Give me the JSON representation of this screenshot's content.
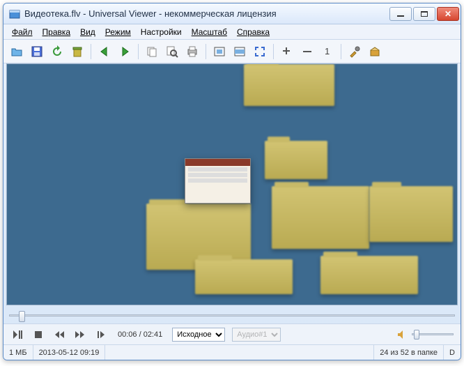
{
  "title": "Видеотека.flv - Universal Viewer - некоммерческая лицензия",
  "menu": {
    "file": "Файл",
    "edit": "Правка",
    "view": "Вид",
    "mode": "Режим",
    "settings": "Настройки",
    "zoom": "Масштаб",
    "help": "Справка"
  },
  "toolbar_icons": {
    "open": "open-icon",
    "save": "save-icon",
    "reload": "reload-icon",
    "delete": "delete-icon",
    "back": "back-icon",
    "forward": "forward-icon",
    "copy": "copy-icon",
    "search": "search-icon",
    "print": "print-icon",
    "fit_window": "fit-window-icon",
    "fit_width": "fit-width-icon",
    "fullscreen": "fullscreen-icon",
    "zoom_in": "zoom-in-icon",
    "zoom_out": "zoom-out-icon",
    "zoom_100": "zoom-100-icon",
    "tools": "tools-icon",
    "plugins": "plugins-icon"
  },
  "playback": {
    "position_seconds": 6,
    "duration_seconds": 161,
    "time_display": "00:06 / 02:41",
    "scale_selected": "Исходное",
    "audio_selected": "Аудио#1"
  },
  "status": {
    "size": "1 МБ",
    "date": "2013-05-12 09:19",
    "position": "24 из 52 в папке",
    "extra": "D"
  },
  "colors": {
    "viewport_bg": "#3d6a8f",
    "folder": "#c8ba68",
    "close_btn": "#d6462f"
  }
}
